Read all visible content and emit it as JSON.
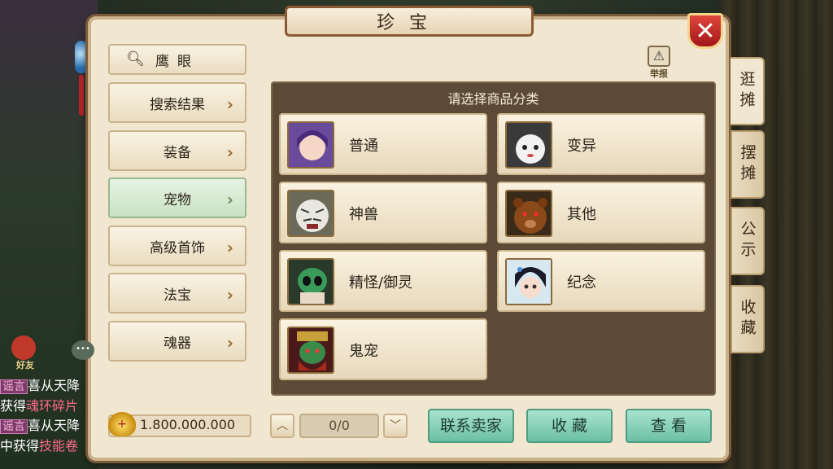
{
  "window": {
    "title": "珍宝",
    "report_label": "举报",
    "close_symbol": "✕"
  },
  "sidebar": {
    "search_label": "鹰眼",
    "items": [
      {
        "label": "搜索结果"
      },
      {
        "label": "装备"
      },
      {
        "label": "宠物",
        "active": true
      },
      {
        "label": "高级首饰"
      },
      {
        "label": "法宝"
      },
      {
        "label": "魂器"
      }
    ]
  },
  "gold": {
    "amount": "1.800.000.000",
    "icon": "gold-ingot-icon"
  },
  "panel": {
    "title": "请选择商品分类",
    "categories": [
      {
        "label": "普通",
        "icon": "girl-portrait-icon"
      },
      {
        "label": "变异",
        "icon": "white-creature-icon"
      },
      {
        "label": "神兽",
        "icon": "white-tiger-icon"
      },
      {
        "label": "其他",
        "icon": "bear-icon"
      },
      {
        "label": "精怪/御灵",
        "icon": "masked-spirit-icon"
      },
      {
        "label": "纪念",
        "icon": "chibi-girl-icon"
      },
      {
        "label": "鬼宠",
        "icon": "green-demon-icon"
      }
    ]
  },
  "pagination": {
    "value": "0/0"
  },
  "actions": {
    "contact": "联系卖家",
    "favorite": "收 藏",
    "view": "查 看"
  },
  "right_tabs": [
    {
      "label": "逛摊",
      "active": true
    },
    {
      "label": "摆摊"
    },
    {
      "label": "公示"
    },
    {
      "label": "收藏"
    }
  ],
  "chat": {
    "friend_label": "好友",
    "lines": [
      {
        "tag": "谣言",
        "text": "喜从天降"
      },
      {
        "text": "获得",
        "highlight": "魂环碎片"
      },
      {
        "tag": "谣言",
        "text": "喜从天降"
      },
      {
        "text": "中获得",
        "highlight": "技能卷"
      }
    ]
  },
  "colors": {
    "accent_green": "#6cc0a4",
    "panel_bg": "#5a4a36",
    "close_red": "#c0302a"
  }
}
